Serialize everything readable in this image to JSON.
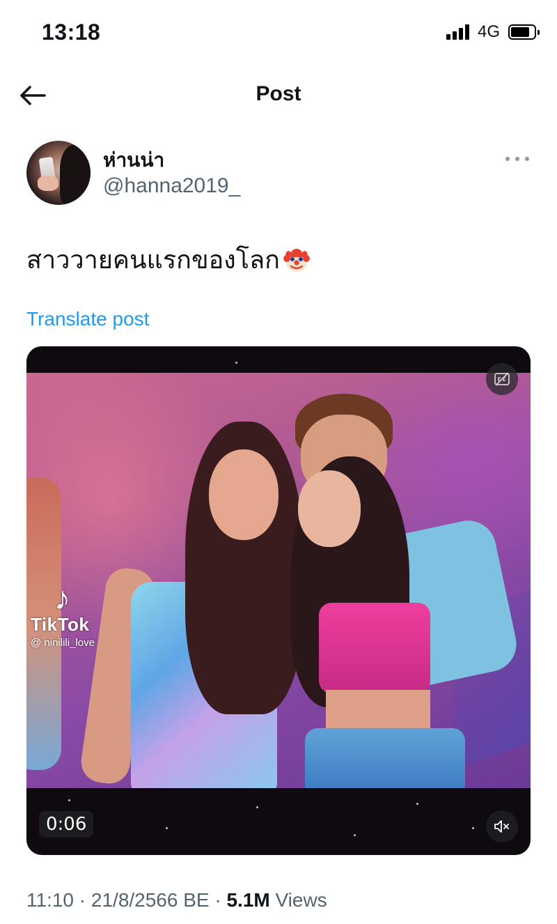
{
  "status_bar": {
    "time": "13:18",
    "network": "4G",
    "battery_level": 0.8
  },
  "header": {
    "title": "Post"
  },
  "author": {
    "display_name": "ห่านน่า",
    "handle": "@hanna2019_"
  },
  "post": {
    "text": "สาววายคนแรกของโลก",
    "emoji_icon": "clown-face-icon",
    "translate_label": "Translate post"
  },
  "video": {
    "duration": "0:06",
    "watermark_brand": "TikTok",
    "watermark_user": "@ ninilili_love",
    "captions_icon": "closed-captions-off-icon",
    "sound_icon": "speaker-muted-icon"
  },
  "meta": {
    "time": "11:10",
    "separator": " · ",
    "date": "21/8/2566 BE",
    "views_count": "5.1M",
    "views_label": " Views"
  },
  "colors": {
    "accent": "#1d9bf0",
    "secondary_text": "#536471",
    "primary_text": "#0f1419"
  }
}
